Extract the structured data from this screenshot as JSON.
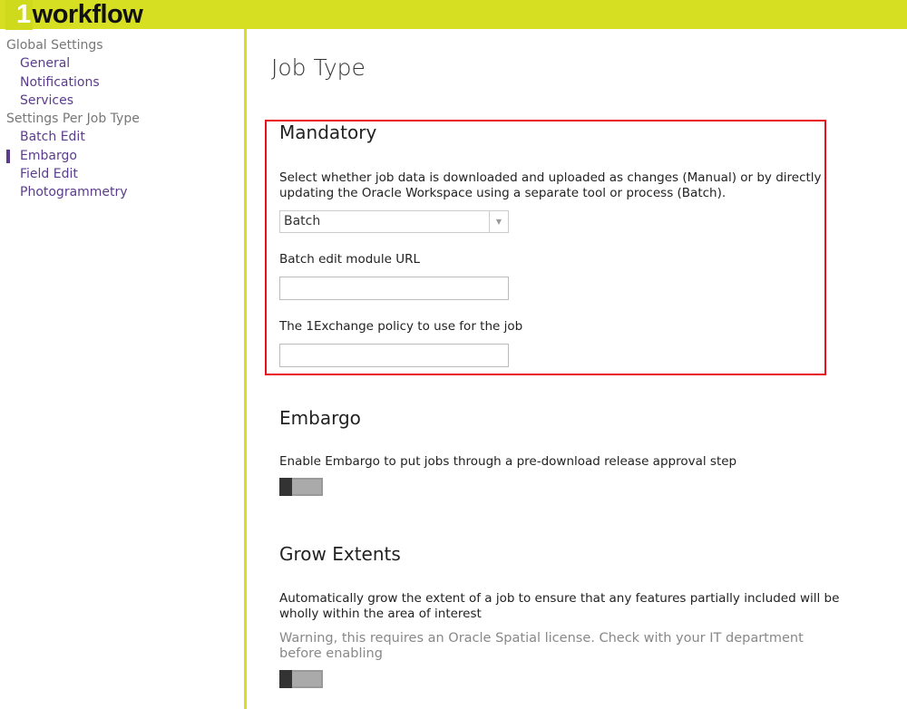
{
  "header": {
    "logo_number": "1",
    "logo_word": "workflow",
    "brand_color": "#d6df22"
  },
  "sidebar": {
    "groups": [
      {
        "label": "Global Settings",
        "items": [
          "General",
          "Notifications",
          "Services"
        ]
      },
      {
        "label": "Settings Per Job Type",
        "items": [
          "Batch Edit",
          "Embargo",
          "Field Edit",
          "Photogrammetry"
        ]
      }
    ],
    "active_item": "Embargo"
  },
  "main": {
    "title": "Job Type",
    "mandatory": {
      "heading": "Mandatory",
      "description": "Select whether job data is downloaded and uploaded as changes (Manual) or by directly updating the Oracle Workspace using a separate tool or process (Batch).",
      "mode_select": {
        "value": "Batch"
      },
      "url_label": "Batch edit module URL",
      "url_value": "",
      "policy_label": "The 1Exchange policy to use for the job",
      "policy_value": ""
    },
    "embargo": {
      "heading": "Embargo",
      "description": "Enable Embargo to put jobs through a pre-download release approval step",
      "enabled": false
    },
    "grow_extents": {
      "heading": "Grow Extents",
      "description": "Automatically grow the extent of a job to ensure that any features partially included will be wholly within the area of interest",
      "warning": "Warning, this requires an Oracle Spatial license. Check with your IT department before enabling",
      "enabled": false
    }
  }
}
